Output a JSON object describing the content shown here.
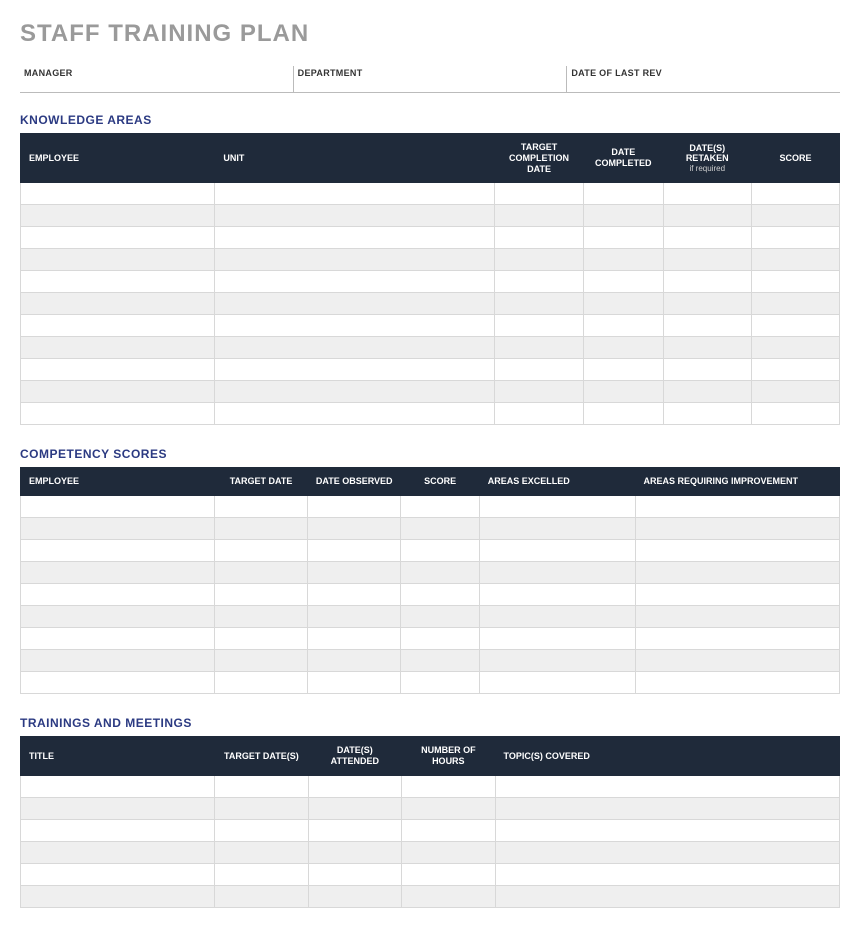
{
  "title": "STAFF TRAINING PLAN",
  "meta": {
    "manager_label": "MANAGER",
    "manager_value": "",
    "department_label": "DEPARTMENT",
    "department_value": "",
    "last_rev_label": "DATE OF LAST REV",
    "last_rev_value": ""
  },
  "knowledge_areas": {
    "section_title": "KNOWLEDGE AREAS",
    "headers": {
      "employee": "EMPLOYEE",
      "unit": "UNIT",
      "target_completion": "TARGET COMPLETION DATE",
      "date_completed": "DATE COMPLETED",
      "dates_retaken": "DATE(S) RETAKEN",
      "dates_retaken_sub": "if required",
      "score": "SCORE"
    },
    "rows": 11
  },
  "competency_scores": {
    "section_title": "COMPETENCY SCORES",
    "headers": {
      "employee": "EMPLOYEE",
      "target_date": "TARGET DATE",
      "date_observed": "DATE OBSERVED",
      "score": "SCORE",
      "areas_excelled": "AREAS EXCELLED",
      "areas_improve": "AREAS REQUIRING IMPROVEMENT"
    },
    "rows": 9
  },
  "trainings_meetings": {
    "section_title": "TRAININGS AND MEETINGS",
    "headers": {
      "title": "TITLE",
      "target_dates": "TARGET DATE(S)",
      "dates_attended": "DATE(S) ATTENDED",
      "num_hours": "NUMBER OF HOURS",
      "topics": "TOPIC(S) COVERED"
    },
    "rows": 6
  }
}
